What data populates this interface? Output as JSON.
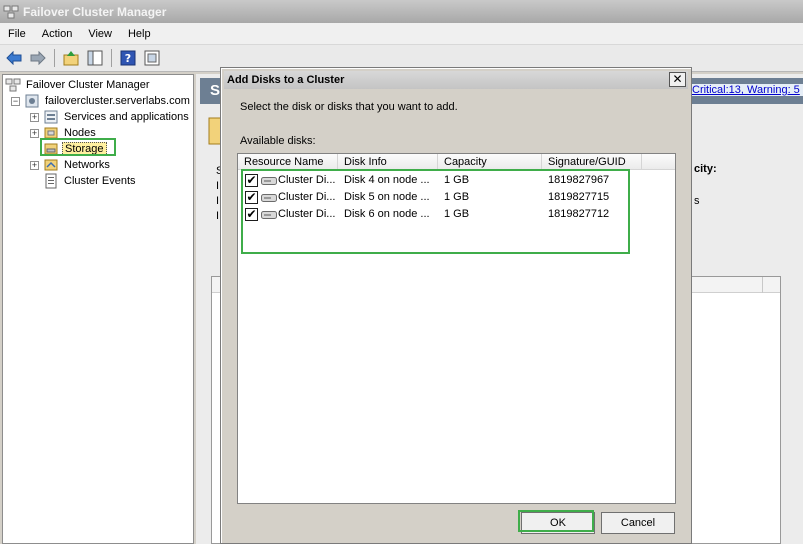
{
  "window": {
    "title": "Failover Cluster Manager"
  },
  "menubar": {
    "items": [
      "File",
      "Action",
      "View",
      "Help"
    ]
  },
  "toolbar": {
    "icons": [
      "back-arrow-icon",
      "forward-arrow-icon",
      "up-folder-icon",
      "show-hide-tree-icon",
      "help-icon",
      "properties-icon"
    ]
  },
  "tree": {
    "root": "Failover Cluster Manager",
    "cluster": "failovercluster.serverlabs.com",
    "items": [
      "Services and applications",
      "Nodes",
      "Storage",
      "Networks",
      "Cluster Events"
    ]
  },
  "right_pane": {
    "header_initial": "S",
    "link_text": "Critical:13, Warning: 5",
    "capacity_label": "city:",
    "fragment_s": "s",
    "side_chars": [
      "S",
      "I",
      "I",
      "I"
    ]
  },
  "dialog": {
    "title": "Add Disks to a Cluster",
    "instruction": "Select the disk or disks that you want to add.",
    "available_label": "Available disks:",
    "columns": [
      "Resource Name",
      "Disk Info",
      "Capacity",
      "Signature/GUID"
    ],
    "rows": [
      {
        "checked": true,
        "name": "Cluster Di...",
        "info": "Disk 4 on node ...",
        "capacity": "1 GB",
        "signature": "1819827967"
      },
      {
        "checked": true,
        "name": "Cluster Di...",
        "info": "Disk 5 on node ...",
        "capacity": "1 GB",
        "signature": "1819827715"
      },
      {
        "checked": true,
        "name": "Cluster Di...",
        "info": "Disk 6 on node ...",
        "capacity": "1 GB",
        "signature": "1819827712"
      }
    ],
    "ok_label": "OK",
    "cancel_label": "Cancel",
    "check_mark": "✔",
    "close_glyph": "✕"
  },
  "colors": {
    "highlight": "#3fad4a",
    "header": "#6d7f93"
  }
}
